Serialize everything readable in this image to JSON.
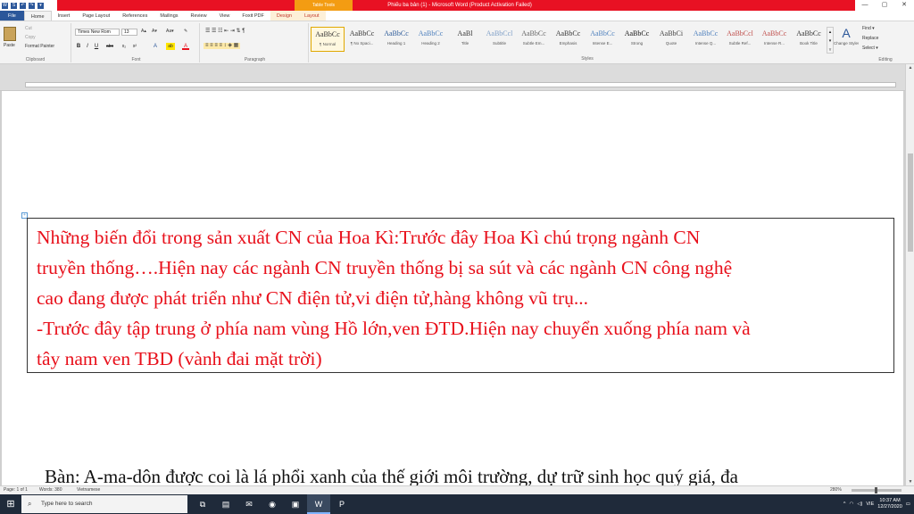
{
  "titlebar": {
    "document_title": "Phiếu ba bản (1) - Microsoft Word (Product Activation Failed)",
    "tool_group": "Table Tools",
    "qat": [
      "W",
      "S",
      "↶",
      "↷",
      "▾"
    ],
    "controls": {
      "minimize": "—",
      "maximize": "▢",
      "close": "✕"
    }
  },
  "tabs": [
    {
      "label": "File",
      "kind": "file"
    },
    {
      "label": "Home",
      "kind": "active"
    },
    {
      "label": "Insert",
      "kind": ""
    },
    {
      "label": "Page Layout",
      "kind": ""
    },
    {
      "label": "References",
      "kind": ""
    },
    {
      "label": "Mailings",
      "kind": ""
    },
    {
      "label": "Review",
      "kind": ""
    },
    {
      "label": "View",
      "kind": ""
    },
    {
      "label": "Foxit PDF",
      "kind": ""
    },
    {
      "label": "Design",
      "kind": "tool"
    },
    {
      "label": "Layout",
      "kind": "tool"
    }
  ],
  "ribbon": {
    "clipboard": {
      "label": "Clipboard",
      "paste": "Paste",
      "cut": "Cut",
      "copy": "Copy",
      "format_painter": "Format Painter"
    },
    "font": {
      "label": "Font",
      "family": "Times New Rom",
      "size": "13",
      "grow": "A▴",
      "shrink": "A▾",
      "case": "Aa▾",
      "clear": "✎",
      "bold": "B",
      "italic": "I",
      "underline": "U",
      "strike": "abc",
      "sub": "x₂",
      "sup": "x²",
      "effects": "A",
      "highlight": "ab",
      "color": "A"
    },
    "paragraph": {
      "label": "Paragraph",
      "row1": "☰ ☰ ☷  ⇤ ⇥  ⇅  ¶",
      "row2": "≡ ≡ ≡ ≡  ↕  ◈  ▦"
    },
    "styles": {
      "label": "Styles",
      "items": [
        {
          "sample": "AaBbCc",
          "name": "¶ Normal",
          "selected": true,
          "color": "#333333"
        },
        {
          "sample": "AaBbCc",
          "name": "¶ No Spaci...",
          "selected": false,
          "color": "#333333"
        },
        {
          "sample": "AaBbCc",
          "name": "Heading 1",
          "selected": false,
          "color": "#2e5c9a"
        },
        {
          "sample": "AaBbCc",
          "name": "Heading 2",
          "selected": false,
          "color": "#4f81bd"
        },
        {
          "sample": "AaBl",
          "name": "Title",
          "selected": false,
          "color": "#333333"
        },
        {
          "sample": "AaBbCcl",
          "name": "Subtitle",
          "selected": false,
          "color": "#7f9fc7"
        },
        {
          "sample": "AaBbCc",
          "name": "Subtle Em...",
          "selected": false,
          "color": "#666666"
        },
        {
          "sample": "AaBbCc",
          "name": "Emphasis",
          "selected": false,
          "color": "#333333"
        },
        {
          "sample": "AaBbCc",
          "name": "Intense E...",
          "selected": false,
          "color": "#4f81bd"
        },
        {
          "sample": "AaBbCc",
          "name": "Strong",
          "selected": false,
          "color": "#111111"
        },
        {
          "sample": "AaBbCi",
          "name": "Quote",
          "selected": false,
          "color": "#444444"
        },
        {
          "sample": "AaBbCc",
          "name": "Intense Q...",
          "selected": false,
          "color": "#4f81bd"
        },
        {
          "sample": "AaBbCcl",
          "name": "Subtle Ref...",
          "selected": false,
          "color": "#c0504d"
        },
        {
          "sample": "AaBbCc",
          "name": "Intense R...",
          "selected": false,
          "color": "#c0504d"
        },
        {
          "sample": "AaBbCc",
          "name": "Book Title",
          "selected": false,
          "color": "#333333"
        }
      ],
      "change_styles": "Change Styles ▾"
    },
    "editing": {
      "label": "Editing",
      "find": "Find ▾",
      "replace": "Replace",
      "select": "Select ▾"
    }
  },
  "document": {
    "cell_lines": [
      "Những biến đổi trong sản xuất CN của Hoa Kì:Trước đây Hoa Kì chú trọng ngành CN",
      "truyền thống….Hiện nay các ngành CN truyền thống bị sa sút và các ngành CN công nghệ",
      "cao đang được phát triển như CN điện tử,vi điện tử,hàng không vũ trụ...",
      "-Trước đây tập trung ở phía nam vùng Hồ lớn,ven ĐTD.Hiện nay chuyển xuống phía nam và",
      "tây nam ven TBD (vành đai mặt trời)"
    ],
    "next_paragraph": "Bàn: A-ma-dôn được coi là lá phổi xanh của thế giới môi trường, dự trữ sinh học quý giá, đa",
    "text_color": "#e8101b"
  },
  "statusbar": {
    "page": "Page: 1 of 1",
    "words": "Words: 380",
    "language": "Vietnamese",
    "zoom": "280%"
  },
  "taskbar": {
    "search_placeholder": "Type here to search",
    "apps": [
      {
        "glyph": "⧉",
        "name": "task-view-icon",
        "active": false
      },
      {
        "glyph": "▤",
        "name": "file-explorer-icon",
        "active": false
      },
      {
        "glyph": "✉",
        "name": "mail-icon",
        "active": false
      },
      {
        "glyph": "◉",
        "name": "chrome-icon",
        "active": false
      },
      {
        "glyph": "▣",
        "name": "excel-icon",
        "active": false
      },
      {
        "glyph": "W",
        "name": "word-icon",
        "active": true
      },
      {
        "glyph": "P",
        "name": "foxit-icon",
        "active": false
      }
    ],
    "time": "10:37 AM",
    "date": "12/27/2020",
    "language": "VIE"
  }
}
